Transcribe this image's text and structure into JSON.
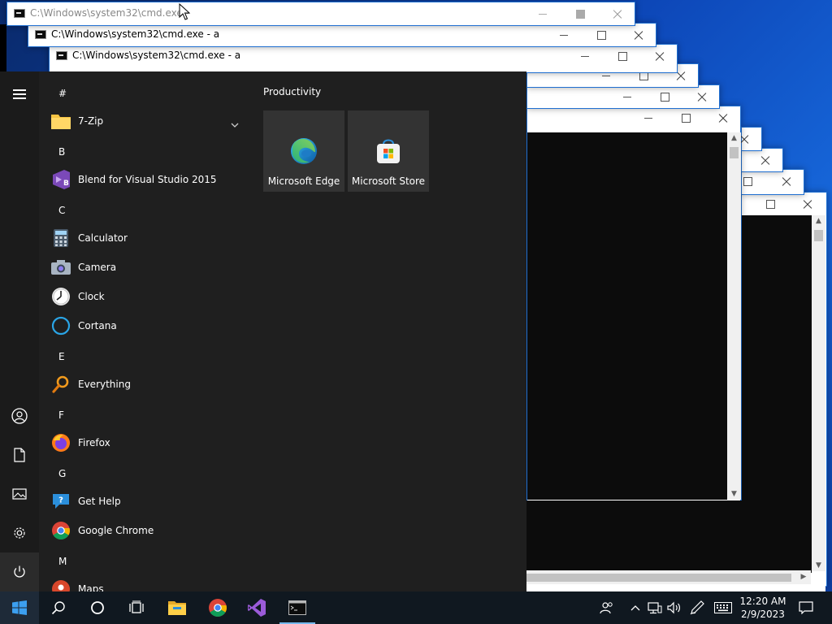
{
  "windows": [
    {
      "title": "C:\\Windows\\system32\\cmd.exe - ",
      "state": "inactive"
    },
    {
      "title": "C:\\Windows\\system32\\cmd.exe - a",
      "state": "normal"
    },
    {
      "title": "C:\\Windows\\system32\\cmd.exe - a",
      "state": "normal"
    },
    {
      "title": "",
      "state": "normal"
    },
    {
      "title": "",
      "state": "normal"
    },
    {
      "title": "",
      "state": "normal"
    },
    {
      "title": "",
      "state": "normal"
    },
    {
      "title": "",
      "state": "normal"
    },
    {
      "title": "",
      "state": "normal"
    },
    {
      "title": "",
      "state": "normal"
    }
  ],
  "start_menu": {
    "rail": {
      "menu_icon": "hamburger-icon",
      "account_icon": "user-icon",
      "documents_icon": "document-icon",
      "pictures_icon": "picture-icon",
      "settings_icon": "gear-icon",
      "power_icon": "power-icon"
    },
    "sections": [
      {
        "letter": "#",
        "apps": [
          {
            "label": "7-Zip",
            "icon": "folder-icon",
            "expandable": true
          }
        ]
      },
      {
        "letter": "B",
        "apps": [
          {
            "label": "Blend for Visual Studio 2015",
            "icon": "blend-icon"
          }
        ]
      },
      {
        "letter": "C",
        "apps": [
          {
            "label": "Calculator",
            "icon": "calculator-icon"
          },
          {
            "label": "Camera",
            "icon": "camera-icon"
          },
          {
            "label": "Clock",
            "icon": "clock-icon"
          },
          {
            "label": "Cortana",
            "icon": "cortana-icon"
          }
        ]
      },
      {
        "letter": "E",
        "apps": [
          {
            "label": "Everything",
            "icon": "everything-icon"
          }
        ]
      },
      {
        "letter": "F",
        "apps": [
          {
            "label": "Firefox",
            "icon": "firefox-icon"
          }
        ]
      },
      {
        "letter": "G",
        "apps": [
          {
            "label": "Get Help",
            "icon": "get-help-icon"
          },
          {
            "label": "Google Chrome",
            "icon": "chrome-icon"
          }
        ]
      },
      {
        "letter": "M",
        "apps": [
          {
            "label": "Maps",
            "icon": "maps-icon"
          }
        ]
      }
    ],
    "tile_group": {
      "title": "Productivity",
      "tiles": [
        {
          "label": "Microsoft Edge",
          "icon": "edge-icon"
        },
        {
          "label": "Microsoft Store",
          "icon": "store-icon"
        }
      ]
    }
  },
  "taskbar": {
    "buttons": [
      {
        "name": "start",
        "icon": "windows-logo-icon"
      },
      {
        "name": "search",
        "icon": "search-icon"
      },
      {
        "name": "cortana",
        "icon": "cortana-circle-icon"
      },
      {
        "name": "task-view",
        "icon": "task-view-icon"
      },
      {
        "name": "file-explorer",
        "icon": "folder-icon"
      },
      {
        "name": "chrome",
        "icon": "chrome-icon"
      },
      {
        "name": "visual-studio",
        "icon": "visual-studio-icon"
      },
      {
        "name": "command-prompt",
        "icon": "cmd-icon",
        "active": true
      }
    ],
    "tray": {
      "people_icon": "people-icon",
      "chevron_icon": "chevron-up-icon",
      "network_icon": "network-icon",
      "volume_icon": "volume-icon",
      "pen_icon": "pen-icon",
      "keyboard_icon": "keyboard-icon",
      "time": "12:20 AM",
      "date": "2/9/2023",
      "notifications_icon": "notification-icon"
    }
  },
  "colors": {
    "start_bg": "#1f1f1f",
    "taskbar_bg": "#101820",
    "accent": "#76b9ed",
    "console_bg": "#0c0c0c"
  }
}
